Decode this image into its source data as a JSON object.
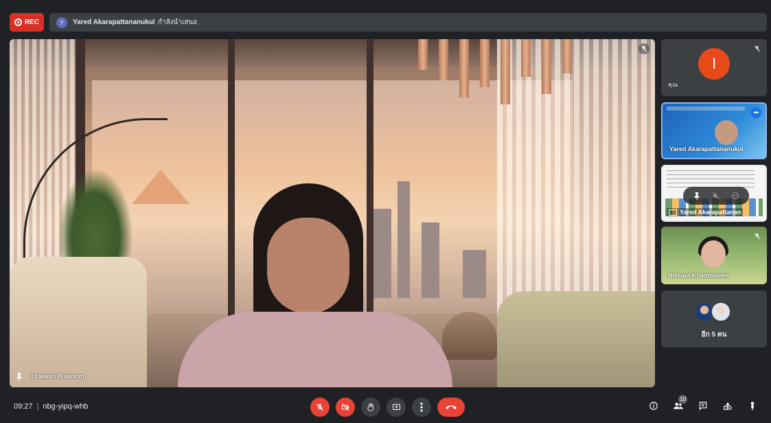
{
  "recording": {
    "label": "REC"
  },
  "presenting": {
    "avatar_initial": "Y",
    "presenter_name": "Yared Akarapattananukul",
    "status_text": "กำลังนำเสนอ"
  },
  "main_video": {
    "participant_name": "Uraiwan Buatoom",
    "muted": true
  },
  "sidebar": {
    "self_tile": {
      "avatar_initial": "I",
      "label": "คุณ",
      "avatar_color": "#e64a19"
    },
    "presenter_tile": {
      "label": "Yared Akarapattananukul"
    },
    "screen_share_tile": {
      "label": "Yared Akarapattanan"
    },
    "nissara_tile": {
      "label": "Nissara Khammanee"
    },
    "others_tile": {
      "label": "อีก 5 คน"
    }
  },
  "bottom_bar": {
    "time": "09:27",
    "meeting_code": "nbg-yipq-whb",
    "people_count": "10"
  },
  "colors": {
    "accent_red": "#ea4335",
    "accent_blue": "#8ab4f8",
    "background": "#202124"
  },
  "icons": [
    "mic-off-icon",
    "camera-off-icon",
    "raise-hand-icon",
    "present-icon",
    "more-options-icon",
    "end-call-icon",
    "info-icon",
    "people-icon",
    "chat-icon",
    "activities-icon",
    "host-controls-icon",
    "pin-icon"
  ]
}
